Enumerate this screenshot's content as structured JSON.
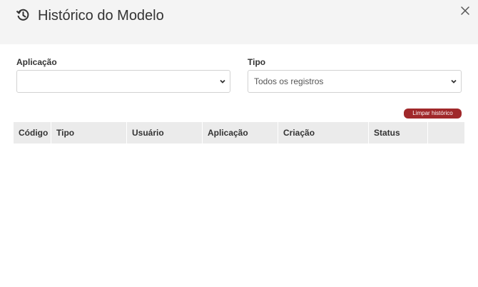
{
  "modal": {
    "title": "Histórico do Modelo",
    "icons": {
      "header": "history-icon",
      "close": "close-icon"
    }
  },
  "filters": {
    "application": {
      "label": "Aplicação",
      "value": ""
    },
    "type": {
      "label": "Tipo",
      "value": "Todos os registros"
    }
  },
  "actions": {
    "clear_label": "Limpar histórico"
  },
  "table": {
    "columns": [
      "Código",
      "Tipo",
      "Usuário",
      "Aplicação",
      "Criação",
      "Status",
      ""
    ],
    "rows": []
  },
  "colors": {
    "header_bg": "#f4f4f4",
    "accent": "#a0282a",
    "table_head_bg": "#ebebeb"
  }
}
